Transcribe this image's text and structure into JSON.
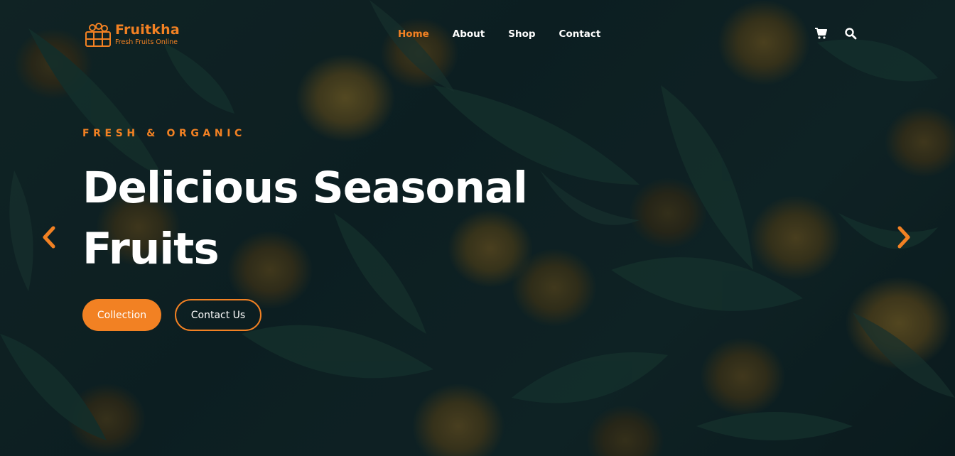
{
  "brand": {
    "name": "Fruitkha",
    "tagline": "Fresh Fruits Online"
  },
  "nav": {
    "items": [
      {
        "label": "Home",
        "active": true
      },
      {
        "label": "About",
        "active": false
      },
      {
        "label": "Shop",
        "active": false
      },
      {
        "label": "Contact",
        "active": false
      }
    ],
    "icons": [
      "cart-icon",
      "search-icon"
    ]
  },
  "hero": {
    "subtitle": "FRESH & ORGANIC",
    "headline": "Delicious Seasonal Fruits",
    "primary_button": "Collection",
    "secondary_button": "Contact Us",
    "prev_icon": "chevron-left-icon",
    "next_icon": "chevron-right-icon"
  },
  "colors": {
    "accent": "#f28123",
    "text": "#ffffff",
    "background": "#0f2124"
  }
}
